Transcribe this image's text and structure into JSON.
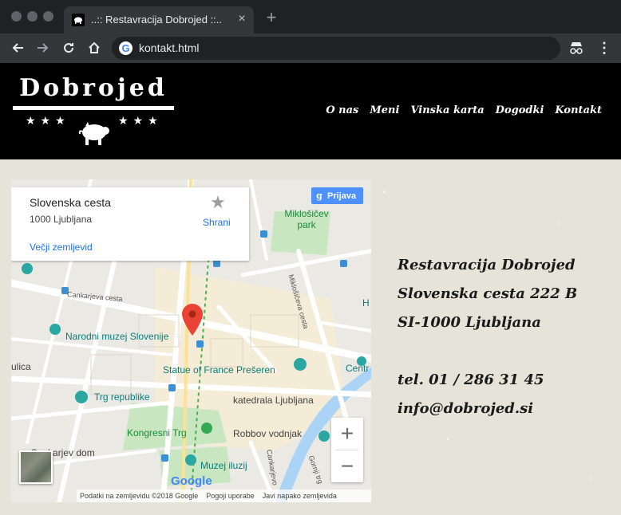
{
  "browser": {
    "tab_title": "..:: Restavracija Dobrojed ::..",
    "url": "kontakt.html",
    "new_tab_symbol": "+",
    "close_symbol": "×"
  },
  "site": {
    "logo_text": "Dobrojed",
    "stars_left": "★★★",
    "stars_right": "★★★",
    "nav": [
      "O nas",
      "Meni",
      "Vinska karta",
      "Dogodki",
      "Kontakt"
    ]
  },
  "map": {
    "infocard": {
      "title": "Slovenska cesta",
      "subtitle": "1000 Ljubljana",
      "link": "Večji zemljevid",
      "save": "Shrani"
    },
    "signin": "Prijava",
    "labels": {
      "miklosicev_park": "Miklošičev park",
      "cankarjeva": "Cankarjeva cesta",
      "miklosiceva": "Miklošičeva cesta",
      "narodni_muzej": "Narodni muzej Slovenije",
      "presern": "Statue of France Prešeren",
      "ulica": "ulica",
      "centr": "Centr",
      "trg_republike": "Trg republike",
      "katedrala": "katedrala Ljubljana",
      "kongresni": "Kongresni Trg",
      "robbov": "Robbov vodnjak",
      "cankarjev_dom": "Cankarjev dom",
      "muzej_iluzij": "Muzej iluzij",
      "cankarjevo": "Cankarjevo",
      "gornji": "Gornji trg",
      "h": "H"
    },
    "google": "Google",
    "attribution": [
      "Podatki na zemljevidu ©2018 Google",
      "Pogoji uporabe",
      "Javi napako zemljevida"
    ]
  },
  "contact": {
    "name": "Restavracija Dobrojed",
    "street": "Slovenska cesta 222 B",
    "city": "SI-1000 Ljubljana",
    "phone": "tel. 01 / 286 31 45",
    "email": "info@dobrojed.si"
  },
  "colors": {
    "header_bg": "#000000",
    "page_bg": "#e6e3d8",
    "accent_blue": "#1a73e8",
    "pin_red": "#ea4335"
  }
}
